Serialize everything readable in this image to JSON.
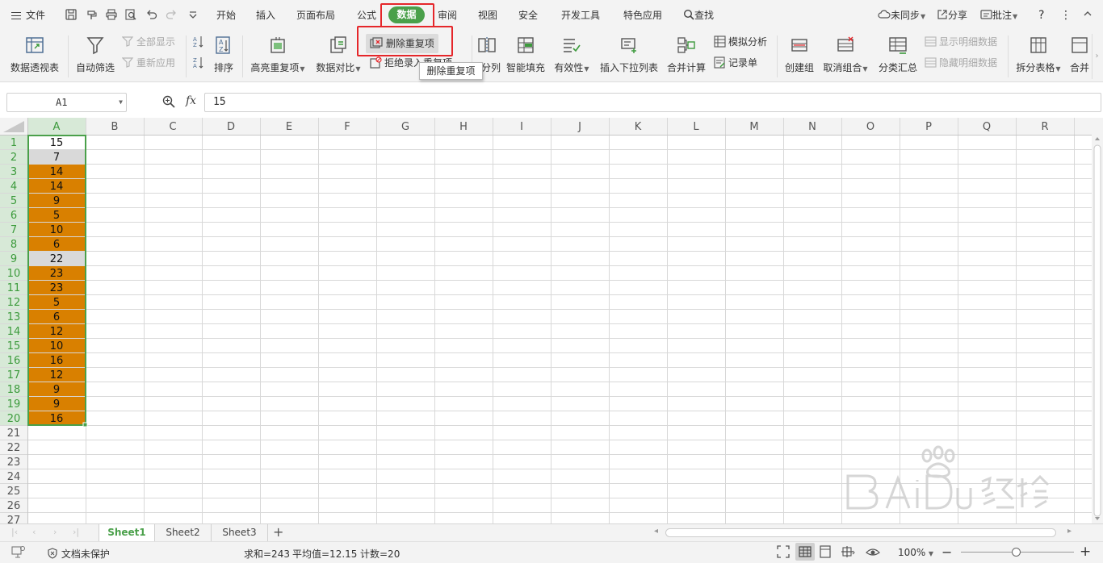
{
  "menu": {
    "file": "文件",
    "tabs": [
      "开始",
      "插入",
      "页面布局",
      "公式",
      "数据",
      "审阅",
      "视图",
      "安全",
      "开发工具",
      "特色应用"
    ],
    "active_tab": "数据",
    "search": "查找",
    "sync": "未同步",
    "share": "分享",
    "comment": "批注",
    "help": "?"
  },
  "ribbon": {
    "pivot": "数据透视表",
    "autofilter": "自动筛选",
    "show_all": "全部显示",
    "reapply": "重新应用",
    "sort": "排序",
    "highlight_dup": "高亮重复项",
    "data_compare": "数据对比",
    "delete_dup": "删除重复项",
    "reject_dup": "拒绝录入重复项",
    "split": "分列",
    "smart_fill": "智能填充",
    "validity": "有效性",
    "insert_dropdown": "插入下拉列表",
    "merge_calc": "合并计算",
    "simulation": "模拟分析",
    "record_form": "记录单",
    "create_group": "创建组",
    "ungroup": "取消组合",
    "subtotal": "分类汇总",
    "show_detail": "显示明细数据",
    "hide_detail": "隐藏明细数据",
    "split_table": "拆分表格",
    "merge_table": "合并"
  },
  "tooltip": "删除重复项",
  "formula": {
    "name_box": "A1",
    "fx": "fx",
    "value": "15"
  },
  "grid": {
    "columns": [
      "A",
      "B",
      "C",
      "D",
      "E",
      "F",
      "G",
      "H",
      "I",
      "J",
      "K",
      "L",
      "M",
      "N",
      "O",
      "P",
      "Q",
      "R"
    ],
    "rows": [
      1,
      2,
      3,
      4,
      5,
      6,
      7,
      8,
      9,
      10,
      11,
      12,
      13,
      14,
      15,
      16,
      17,
      18,
      19,
      20,
      21,
      22,
      23,
      24,
      25,
      26,
      27
    ],
    "column_a_values": [
      15,
      7,
      14,
      14,
      9,
      5,
      10,
      6,
      22,
      23,
      23,
      5,
      6,
      12,
      10,
      16,
      12,
      9,
      9,
      16
    ],
    "highlight_color": "#d98000",
    "unique_fill_color": "#d9d9d9",
    "selection_color": "#4aa04a"
  },
  "sheets": [
    "Sheet1",
    "Sheet2",
    "Sheet3"
  ],
  "active_sheet": "Sheet1",
  "status": {
    "protect": "文档未保护",
    "sum": "求和=243",
    "average": "平均值=12.15",
    "count": "计数=20",
    "zoom": "100%"
  }
}
